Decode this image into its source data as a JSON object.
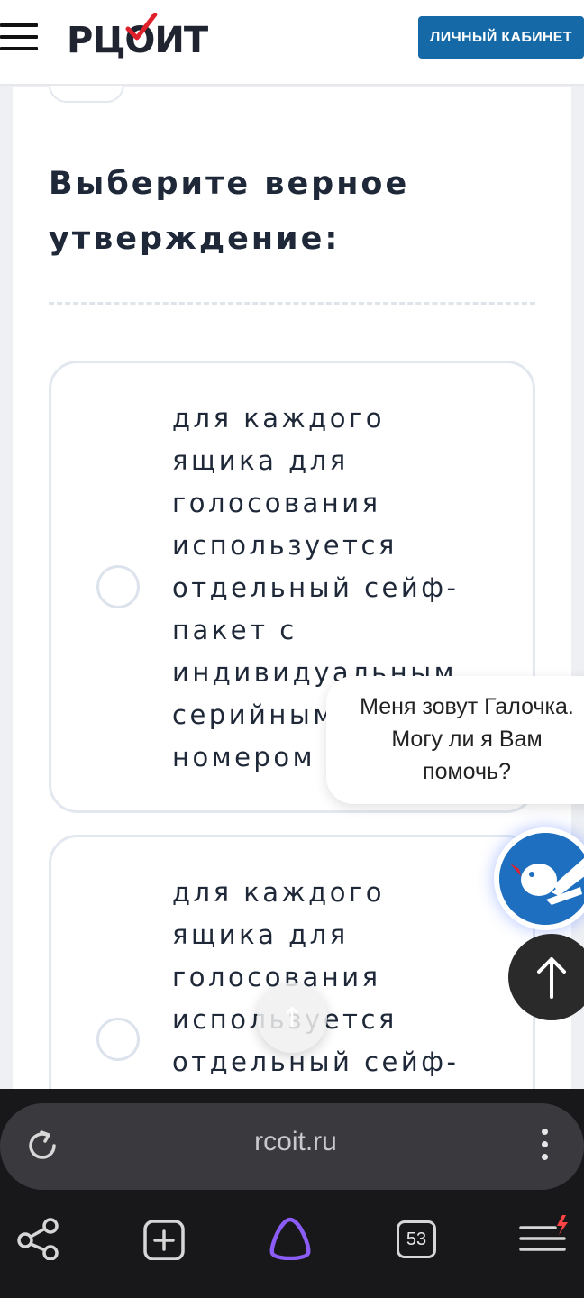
{
  "header": {
    "logo_text": "РЦОИТ",
    "cabinet_button": "ЛИЧНЫЙ КАБИНЕТ"
  },
  "question": {
    "title": "Выберите верное утверждение:"
  },
  "options": [
    {
      "text": "для каждого ящика для голосования используется отдельный сейф-пакет с индивидуальным серийным номером"
    },
    {
      "text": "для каждого ящика для голосования используется отдельный сейф-"
    }
  ],
  "chat": {
    "greeting": "Меня зовут Галочка. Могу ли я Вам помочь?"
  },
  "browser": {
    "url": "rcoit.ru",
    "tabs_count": "53"
  },
  "colors": {
    "accent": "#1569a6",
    "logo_check": "#e0202a",
    "text_dark": "#1e2838"
  },
  "icons": [
    "hamburger-icon",
    "reload-icon",
    "more-icon",
    "share-icon",
    "new-tab-icon",
    "alice-icon",
    "menu-icon",
    "arrow-up-icon"
  ]
}
